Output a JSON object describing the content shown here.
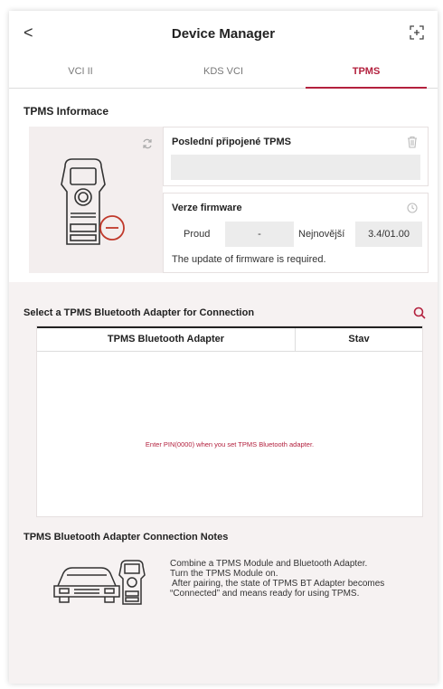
{
  "header": {
    "title": "Device Manager",
    "back_glyph": "<",
    "back_icon": "chevron-left-icon",
    "expand_icon": "expand-icon"
  },
  "tabs": [
    {
      "label": "VCI II",
      "active": false
    },
    {
      "label": "KDS VCI",
      "active": false
    },
    {
      "label": "TPMS",
      "active": true
    }
  ],
  "info": {
    "section_title": "TPMS Informace",
    "last_connected": {
      "title": "Poslední připojené TPMS",
      "value": ""
    },
    "firmware": {
      "title": "Verze firmware",
      "current_label": "Proud",
      "current_value": "-",
      "latest_label": "Nejnovější",
      "latest_value": "3.4/01.00",
      "note": "The update of firmware is required."
    }
  },
  "adapter": {
    "section_title": "Select a TPMS Bluetooth Adapter for Connection",
    "columns": [
      "TPMS Bluetooth Adapter",
      "Stav"
    ],
    "rows": [],
    "hint": "Enter PIN(0000) when you set TPMS Bluetooth adapter."
  },
  "notes": {
    "title": "TPMS Bluetooth Adapter Connection Notes",
    "lines": [
      "Combine a TPMS Module and Bluetooth Adapter.",
      "Turn the TPMS Module on.",
      "After pairing, the state of TPMS BT Adapter becomes",
      "“Connected” and means ready for using TPMS."
    ]
  },
  "colors": {
    "accent": "#b3213e",
    "panel_bg": "#f3eeee",
    "field_bg": "#ececec"
  }
}
